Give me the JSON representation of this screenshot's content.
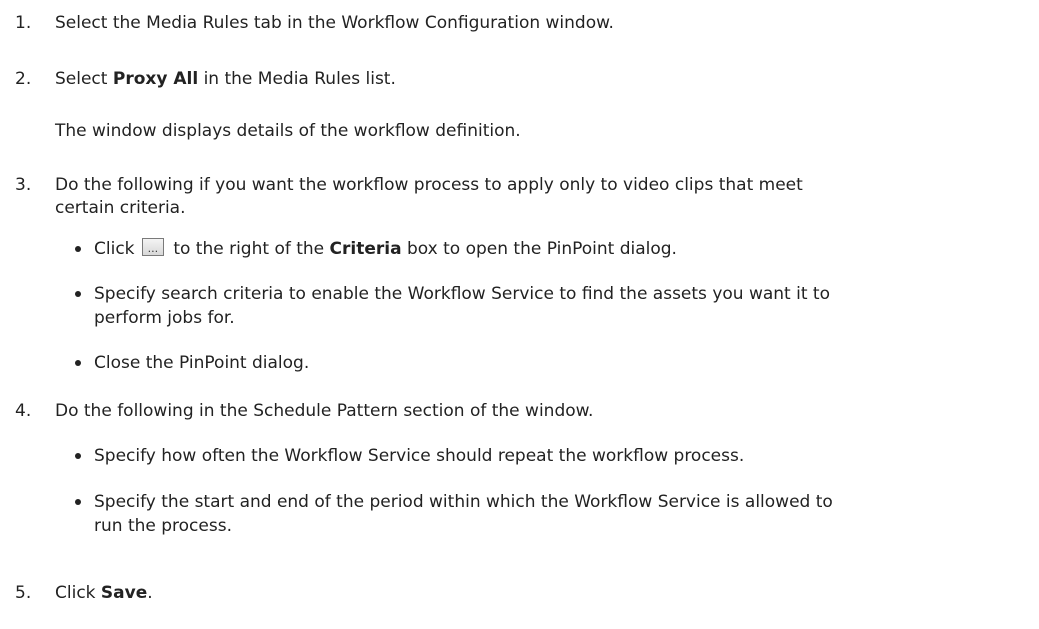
{
  "steps": [
    {
      "num": "1.",
      "text": "Select the Media Rules tab in the Workflow Configuration window."
    },
    {
      "num": "2.",
      "pre": "Select ",
      "bold": "Proxy All",
      "post": " in the Media Rules list."
    },
    {
      "para": "The window displays details of the workflow definition."
    },
    {
      "num": "3.",
      "line1": "Do the following if you want the workflow process to apply only to video clips that meet",
      "line2": "certain criteria."
    },
    {
      "num": "4.",
      "text": "Do the following in the Schedule Pattern section of the window."
    },
    {
      "num": "5.",
      "pre": "Click ",
      "bold": "Save",
      "post": "."
    }
  ],
  "step3_bullets": [
    {
      "pre": "Click ",
      "icon": "ellipsis-button-icon",
      "icon_label": "...",
      "mid": " to the right of the ",
      "bold": "Criteria",
      "post": " box to open the PinPoint dialog."
    },
    {
      "line1": "Specify search criteria to enable the Workflow Service to find the assets you want it to",
      "line2": "perform jobs for."
    },
    {
      "text": "Close the PinPoint dialog."
    }
  ],
  "step4_bullets": [
    {
      "text": "Specify how often the Workflow Service should repeat the workflow process."
    },
    {
      "line1": "Specify the start and end of the period within which the Workflow Service is allowed to",
      "line2": "run the process."
    }
  ]
}
